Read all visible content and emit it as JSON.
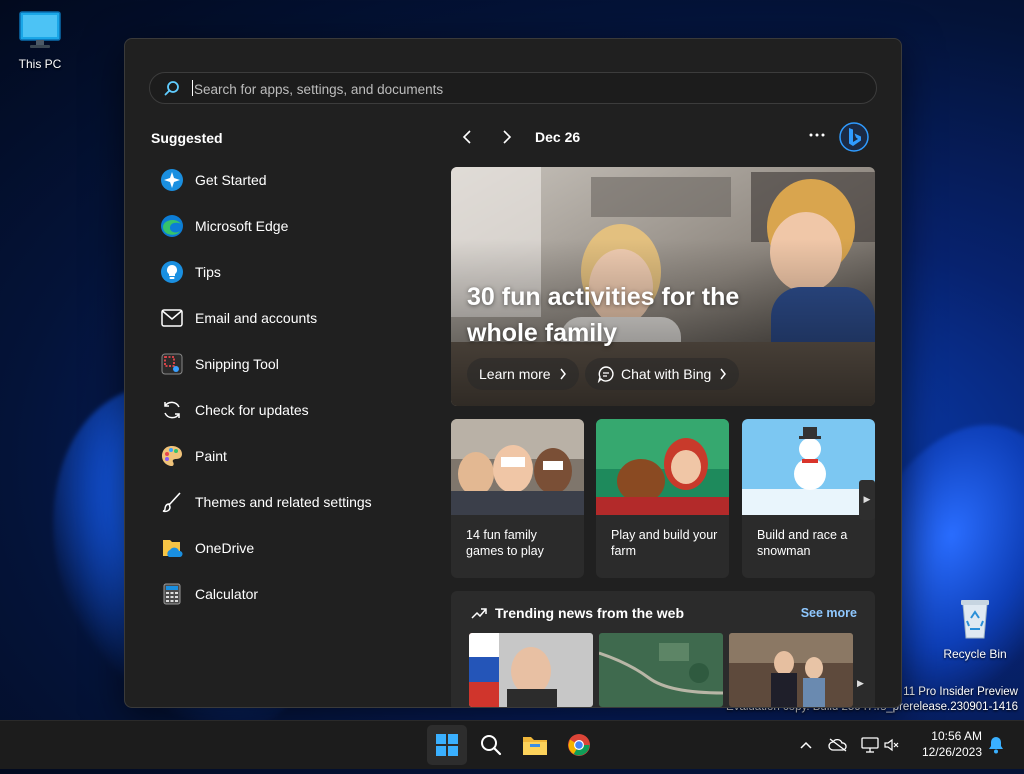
{
  "desktop": {
    "this_pc_label": "This PC",
    "recycle_bin_label": "Recycle Bin",
    "watermark_line1": "s 11 Pro Insider Preview",
    "watermark_line2": "Evaluation copy. Build 25947.rs_prerelease.230901-1416"
  },
  "start_menu": {
    "search": {
      "placeholder": "Search for apps, settings, and documents"
    },
    "suggested": {
      "title": "Suggested",
      "items": [
        {
          "label": "Get Started",
          "icon": "get-started-icon"
        },
        {
          "label": "Microsoft Edge",
          "icon": "edge-icon"
        },
        {
          "label": "Tips",
          "icon": "tips-icon"
        },
        {
          "label": "Email and accounts",
          "icon": "mail-icon"
        },
        {
          "label": "Snipping Tool",
          "icon": "snipping-tool-icon"
        },
        {
          "label": "Check for updates",
          "icon": "refresh-icon"
        },
        {
          "label": "Paint",
          "icon": "paint-icon"
        },
        {
          "label": "Themes and related settings",
          "icon": "brush-icon"
        },
        {
          "label": "OneDrive",
          "icon": "onedrive-icon"
        },
        {
          "label": "Calculator",
          "icon": "calculator-icon"
        }
      ]
    },
    "widgets": {
      "date": "Dec 26",
      "hero": {
        "title": "30 fun activities for the whole family",
        "learn_more": "Learn more",
        "chat_with_bing": "Chat with Bing"
      },
      "cards": [
        {
          "caption": "14 fun family games to play"
        },
        {
          "caption": "Play and build your farm"
        },
        {
          "caption": "Build and race a snowman"
        }
      ],
      "trending": {
        "title": "Trending news from the web",
        "see_more": "See more"
      }
    }
  },
  "taskbar": {
    "time": "10:56 AM",
    "date": "12/26/2023"
  },
  "colors": {
    "accent": "#0078d4",
    "link": "#8fc8ff",
    "panel": "#202020",
    "card": "#2b2b2b"
  }
}
